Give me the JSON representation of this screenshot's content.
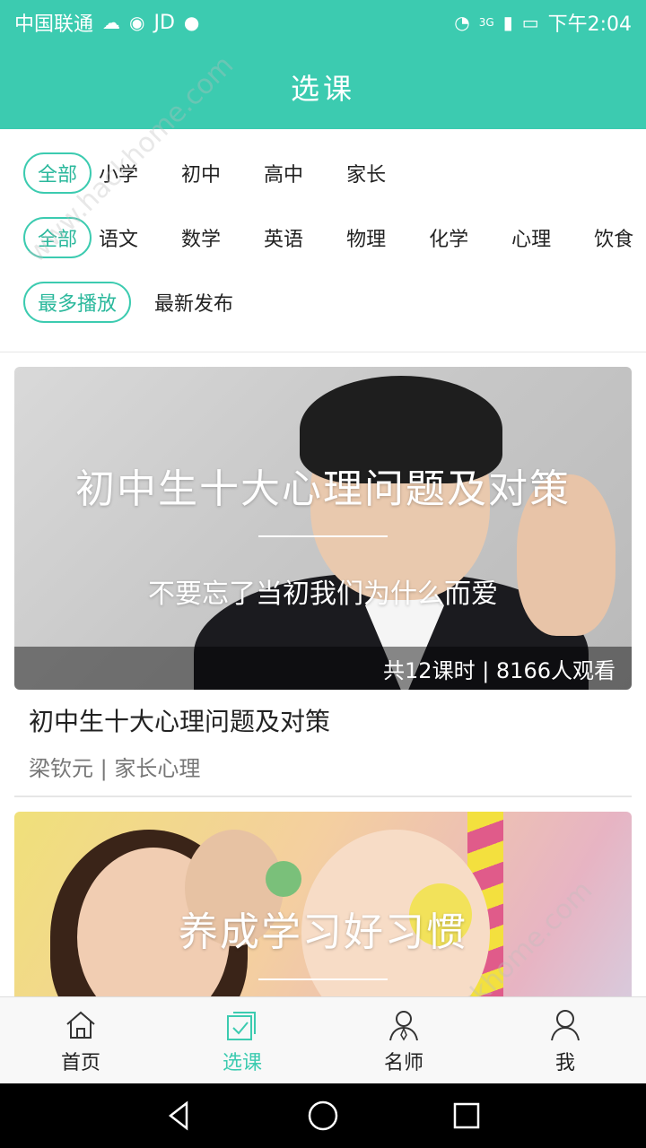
{
  "status_bar": {
    "carrier": "中国联通",
    "extra": "JD",
    "network": "3G",
    "time": "下午2:04"
  },
  "header": {
    "title": "选课"
  },
  "filters": {
    "grade": {
      "items": [
        "全部",
        "小学",
        "初中",
        "高中",
        "家长"
      ],
      "selected_index": 0
    },
    "subject": {
      "items": [
        "全部",
        "语文",
        "数学",
        "英语",
        "物理",
        "化学",
        "心理",
        "饮食"
      ],
      "selected_index": 0
    },
    "sort": {
      "items": [
        "最多播放",
        "最新发布"
      ],
      "selected_index": 0
    }
  },
  "courses": [
    {
      "banner_title": "初中生十大心理问题及对策",
      "banner_subtitle": "不要忘了当初我们为什么而爱",
      "meta": "共12课时 | 8166人观看",
      "title": "初中生十大心理问题及对策",
      "author_line": "梁钦元 | 家长心理"
    },
    {
      "banner_title": "养成学习好习惯"
    }
  ],
  "bottom_nav": [
    {
      "label": "首页",
      "icon": "home-icon",
      "active": false
    },
    {
      "label": "选课",
      "icon": "course-select-icon",
      "active": true
    },
    {
      "label": "名师",
      "icon": "teacher-icon",
      "active": false
    },
    {
      "label": "我",
      "icon": "profile-icon",
      "active": false
    }
  ],
  "colors": {
    "accent": "#3ccbb0",
    "text": "#222222",
    "muted": "#777777"
  }
}
